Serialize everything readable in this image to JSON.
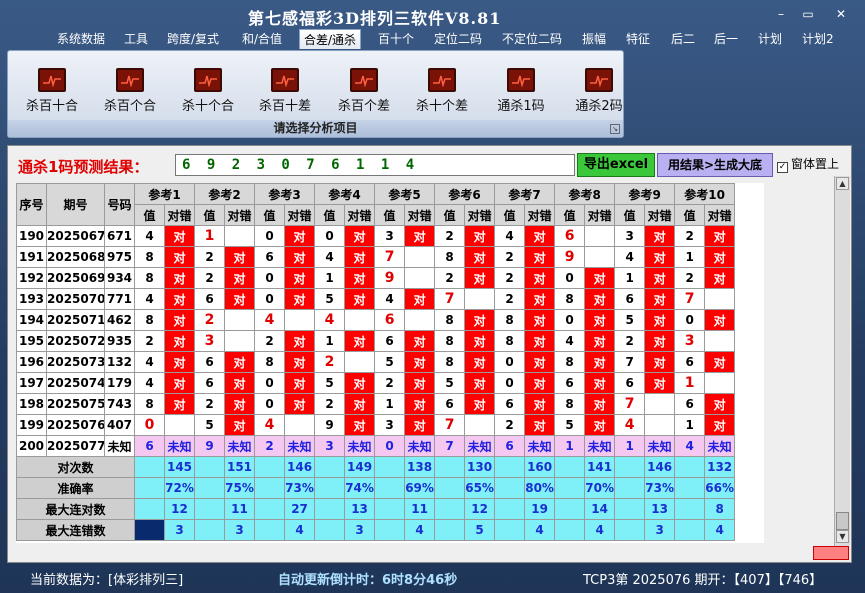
{
  "window": {
    "title": "第七感福彩3D排列三软件V8.81",
    "minimize": "–",
    "maximize": "▭",
    "close": "✕"
  },
  "menu": [
    "系统数据",
    "工具",
    "跨度/复式",
    "和/合值",
    "合差/通杀",
    "百十个",
    "定位二码",
    "不定位二码",
    "振幅",
    "特征",
    "后二",
    "后一",
    "计划",
    "计划2"
  ],
  "menu_active": 4,
  "ribbon": {
    "buttons": [
      "杀百十合",
      "杀百个合",
      "杀十个合",
      "杀百十差",
      "杀百个差",
      "杀十个差",
      "通杀1码",
      "通杀2码"
    ],
    "caption": "请选择分析项目",
    "launcher": "↘"
  },
  "prediction": {
    "label": "通杀1码预测结果：",
    "value": "6 9 2 3 0 7 6 1 1 4",
    "excel_button": "导出excel",
    "generate_button": "用结果>生成大底",
    "topmost_label": "窗体置上",
    "topmost_checked": "✓"
  },
  "table": {
    "headers": {
      "seq": "序号",
      "period": "期号",
      "number": "号码",
      "ref_prefix": "参考",
      "val": "值",
      "hit": "对错"
    },
    "hit_text": "对",
    "rows": [
      {
        "seq": "190",
        "period": "2025067",
        "num": "671",
        "v": [
          "4",
          "1",
          "0",
          "0",
          "3",
          "2",
          "4",
          "6",
          "3",
          "2"
        ],
        "h": [
          1,
          0,
          1,
          1,
          1,
          1,
          1,
          0,
          1,
          1
        ],
        "red": [
          0,
          1,
          0,
          0,
          0,
          0,
          0,
          1,
          0,
          0
        ]
      },
      {
        "seq": "191",
        "period": "2025068",
        "num": "975",
        "v": [
          "8",
          "2",
          "6",
          "4",
          "7",
          "8",
          "2",
          "9",
          "4",
          "1"
        ],
        "h": [
          1,
          1,
          1,
          1,
          0,
          1,
          1,
          0,
          1,
          1
        ],
        "red": [
          0,
          0,
          0,
          0,
          1,
          0,
          0,
          1,
          0,
          0
        ]
      },
      {
        "seq": "192",
        "period": "2025069",
        "num": "934",
        "v": [
          "8",
          "2",
          "0",
          "1",
          "9",
          "2",
          "2",
          "0",
          "1",
          "2"
        ],
        "h": [
          1,
          1,
          1,
          1,
          0,
          1,
          1,
          1,
          1,
          1
        ],
        "red": [
          0,
          0,
          0,
          0,
          1,
          0,
          0,
          0,
          0,
          0
        ]
      },
      {
        "seq": "193",
        "period": "2025070",
        "num": "771",
        "v": [
          "4",
          "6",
          "0",
          "5",
          "4",
          "7",
          "2",
          "8",
          "6",
          "7"
        ],
        "h": [
          1,
          1,
          1,
          1,
          1,
          0,
          1,
          1,
          1,
          0
        ],
        "red": [
          0,
          0,
          0,
          0,
          0,
          1,
          0,
          0,
          0,
          1
        ]
      },
      {
        "seq": "194",
        "period": "2025071",
        "num": "462",
        "v": [
          "8",
          "2",
          "4",
          "4",
          "6",
          "8",
          "8",
          "0",
          "5",
          "0"
        ],
        "h": [
          1,
          0,
          0,
          0,
          0,
          1,
          1,
          1,
          1,
          1
        ],
        "red": [
          0,
          1,
          1,
          1,
          1,
          0,
          0,
          0,
          0,
          0
        ]
      },
      {
        "seq": "195",
        "period": "2025072",
        "num": "935",
        "v": [
          "2",
          "3",
          "2",
          "1",
          "6",
          "8",
          "8",
          "4",
          "2",
          "3"
        ],
        "h": [
          1,
          0,
          1,
          1,
          1,
          1,
          1,
          1,
          1,
          0
        ],
        "red": [
          0,
          1,
          0,
          0,
          0,
          0,
          0,
          0,
          0,
          1
        ]
      },
      {
        "seq": "196",
        "period": "2025073",
        "num": "132",
        "v": [
          "4",
          "6",
          "8",
          "2",
          "5",
          "8",
          "0",
          "8",
          "7",
          "6"
        ],
        "h": [
          1,
          1,
          1,
          0,
          1,
          1,
          1,
          1,
          1,
          1
        ],
        "red": [
          0,
          0,
          0,
          1,
          0,
          0,
          0,
          0,
          0,
          0
        ]
      },
      {
        "seq": "197",
        "period": "2025074",
        "num": "179",
        "v": [
          "4",
          "6",
          "0",
          "5",
          "2",
          "5",
          "0",
          "6",
          "6",
          "1"
        ],
        "h": [
          1,
          1,
          1,
          1,
          1,
          1,
          1,
          1,
          1,
          0
        ],
        "red": [
          0,
          0,
          0,
          0,
          0,
          0,
          0,
          0,
          0,
          1
        ]
      },
      {
        "seq": "198",
        "period": "2025075",
        "num": "743",
        "v": [
          "8",
          "2",
          "0",
          "2",
          "1",
          "6",
          "6",
          "8",
          "7",
          "6"
        ],
        "h": [
          1,
          1,
          1,
          1,
          1,
          1,
          1,
          1,
          0,
          1
        ],
        "red": [
          0,
          0,
          0,
          0,
          0,
          0,
          0,
          0,
          1,
          0
        ]
      },
      {
        "seq": "199",
        "period": "2025076",
        "num": "407",
        "v": [
          "0",
          "5",
          "4",
          "9",
          "3",
          "7",
          "2",
          "5",
          "4",
          "1"
        ],
        "h": [
          0,
          1,
          0,
          1,
          1,
          0,
          1,
          1,
          0,
          1
        ],
        "red": [
          1,
          0,
          1,
          0,
          0,
          1,
          0,
          0,
          1,
          0
        ]
      }
    ],
    "unknown_row": {
      "seq": "200",
      "period": "2025077",
      "num": "未知",
      "v": [
        "6",
        "9",
        "2",
        "3",
        "0",
        "7",
        "6",
        "1",
        "1",
        "4"
      ],
      "hit": "未知"
    },
    "stats": [
      {
        "label": "对次数",
        "values": [
          "145",
          "151",
          "146",
          "149",
          "138",
          "130",
          "160",
          "141",
          "146",
          "132"
        ]
      },
      {
        "label": "准确率",
        "values": [
          "72%",
          "75%",
          "73%",
          "74%",
          "69%",
          "65%",
          "80%",
          "70%",
          "73%",
          "66%"
        ]
      },
      {
        "label": "最大连对数",
        "values": [
          "12",
          "11",
          "27",
          "13",
          "11",
          "12",
          "19",
          "14",
          "13",
          "8"
        ]
      },
      {
        "label": "最大连错数",
        "values": [
          "3",
          "3",
          "4",
          "3",
          "4",
          "5",
          "4",
          "4",
          "3",
          "4"
        ]
      }
    ]
  },
  "status": {
    "left": "当前数据为：[体彩排列三]",
    "mid_label": "自动更新倒计时：",
    "mid_value": "6时8分46秒",
    "right": "TCP3第 2025076 期开：【407】【746】"
  },
  "colors": {
    "hit_red": "#ff0000",
    "stats_cyan": "#7ff0f7",
    "unknown_pink": "#f4c8f0",
    "accent_green": "#3ac83a",
    "accent_purple": "#b8b0f0"
  }
}
